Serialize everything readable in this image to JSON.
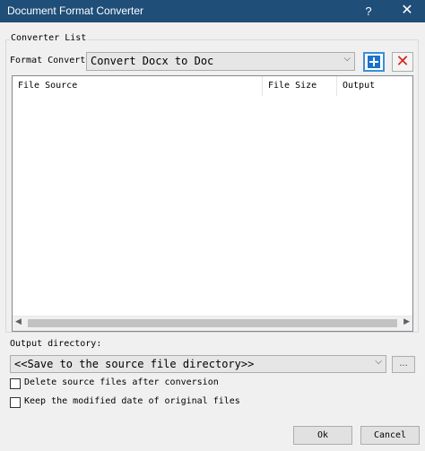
{
  "window": {
    "title": "Document Format Converter",
    "help_glyph": "?",
    "close_glyph": "✕"
  },
  "converter": {
    "group_label": "Converter List",
    "format_label": "Format Convert",
    "format_value": "Convert Docx to Doc",
    "add_icon": "plus-icon",
    "delete_icon": "x-icon",
    "delete_glyph": "✕",
    "accent_color": "#1a73c9",
    "delete_color": "#d8261c"
  },
  "file_list": {
    "columns": [
      "File Source",
      "File Size",
      "Output"
    ],
    "rows": []
  },
  "output": {
    "label": "Output directory:",
    "directory_value": "<<Save to the source file directory>>",
    "browse_label": "..."
  },
  "options": {
    "delete_source": {
      "label": "Delete source files after conversion",
      "checked": false
    },
    "keep_date": {
      "label": "Keep the modified date of original files",
      "checked": false
    }
  },
  "buttons": {
    "ok": "Ok",
    "cancel": "Cancel"
  }
}
